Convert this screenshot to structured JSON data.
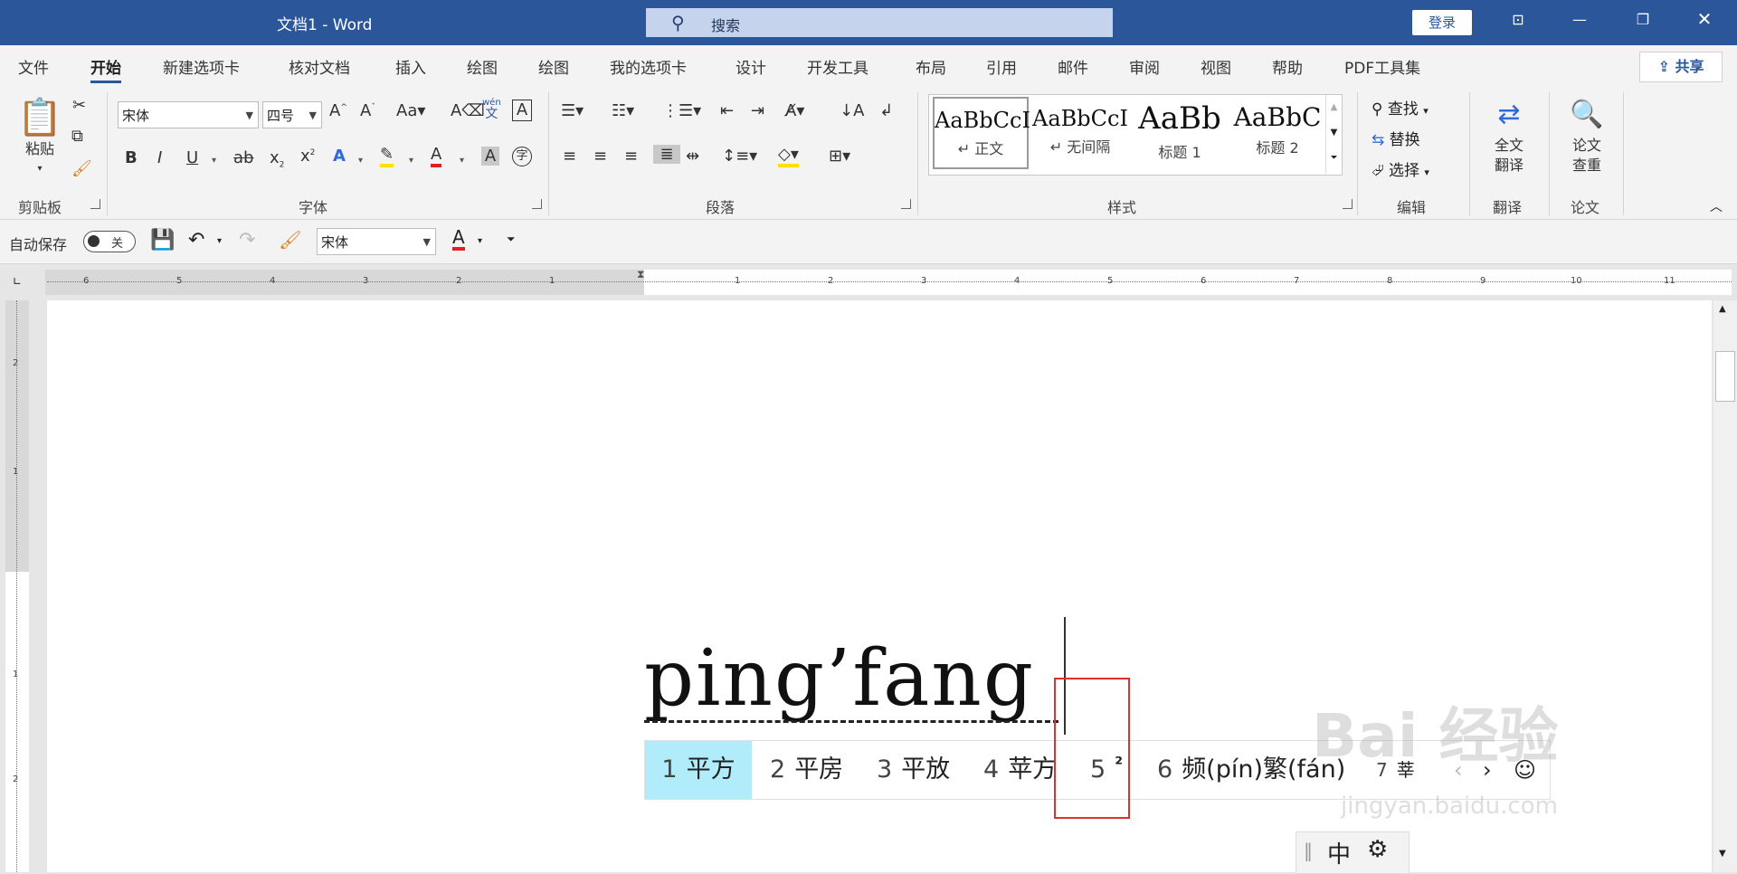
{
  "app": {
    "title": "文档1  -  Word",
    "search_placeholder": "搜索",
    "login_label": "登录"
  },
  "menu_tabs": [
    "文件",
    "开始",
    "新建选项卡",
    "核对文档",
    "插入",
    "绘图",
    "绘图",
    "我的选项卡",
    "设计",
    "开发工具",
    "布局",
    "引用",
    "邮件",
    "审阅",
    "视图",
    "帮助",
    "PDF工具集"
  ],
  "share_label": "共享",
  "ribbon": {
    "clipboard": {
      "paste_label": "粘贴",
      "group_label": "剪贴板"
    },
    "font": {
      "font_name": "宋体",
      "font_size": "四号",
      "group_label": "字体",
      "phonetic_top": "wén",
      "phonetic_bottom": "文",
      "enclose_char": "字"
    },
    "paragraph": {
      "group_label": "段落"
    },
    "styles": {
      "group_label": "样式",
      "items": [
        {
          "sample": "AaBbCcI",
          "name": "↵ 正文"
        },
        {
          "sample": "AaBbCcI",
          "name": "↵ 无间隔"
        },
        {
          "sample": "AaBb",
          "name": "标题 1"
        },
        {
          "sample": "AaBbC",
          "name": "标题 2"
        }
      ]
    },
    "editing": {
      "find": "查找",
      "replace": "替换",
      "select": "选择",
      "group_label": "编辑"
    },
    "translate": {
      "label_line1": "全文",
      "label_line2": "翻译",
      "group_label": "翻译"
    },
    "paper": {
      "label_line1": "论文",
      "label_line2": "查重",
      "group_label": "论文"
    }
  },
  "qat": {
    "autosave_label": "自动保存",
    "toggle_state": "关",
    "font_name": "宋体"
  },
  "ruler": {
    "left_nums": [
      "6",
      "5",
      "4",
      "3",
      "2",
      "1"
    ],
    "right_nums": [
      "1",
      "2",
      "3",
      "4",
      "5",
      "6",
      "7",
      "8",
      "9",
      "10",
      "11"
    ],
    "vert_nums": [
      "2",
      "1",
      "1",
      "2"
    ]
  },
  "document": {
    "typed_text": "ping’fang"
  },
  "ime": {
    "candidates": [
      {
        "n": "1",
        "text": "平方"
      },
      {
        "n": "2",
        "text": "平房"
      },
      {
        "n": "3",
        "text": "平放"
      },
      {
        "n": "4",
        "text": "苹方"
      },
      {
        "n": "5",
        "text": "²"
      },
      {
        "n": "6",
        "text": "频(pín)繁(fán)"
      },
      {
        "n": "7",
        "text": "莘"
      }
    ],
    "mode": "中"
  },
  "watermark": {
    "brand": "Bai 经验",
    "url": "jingyan.baidu.com"
  },
  "colors": {
    "title_bar": "#2b579a",
    "candidate_highlight": "#b0ecfa",
    "highlight_box": "#e0302a"
  }
}
